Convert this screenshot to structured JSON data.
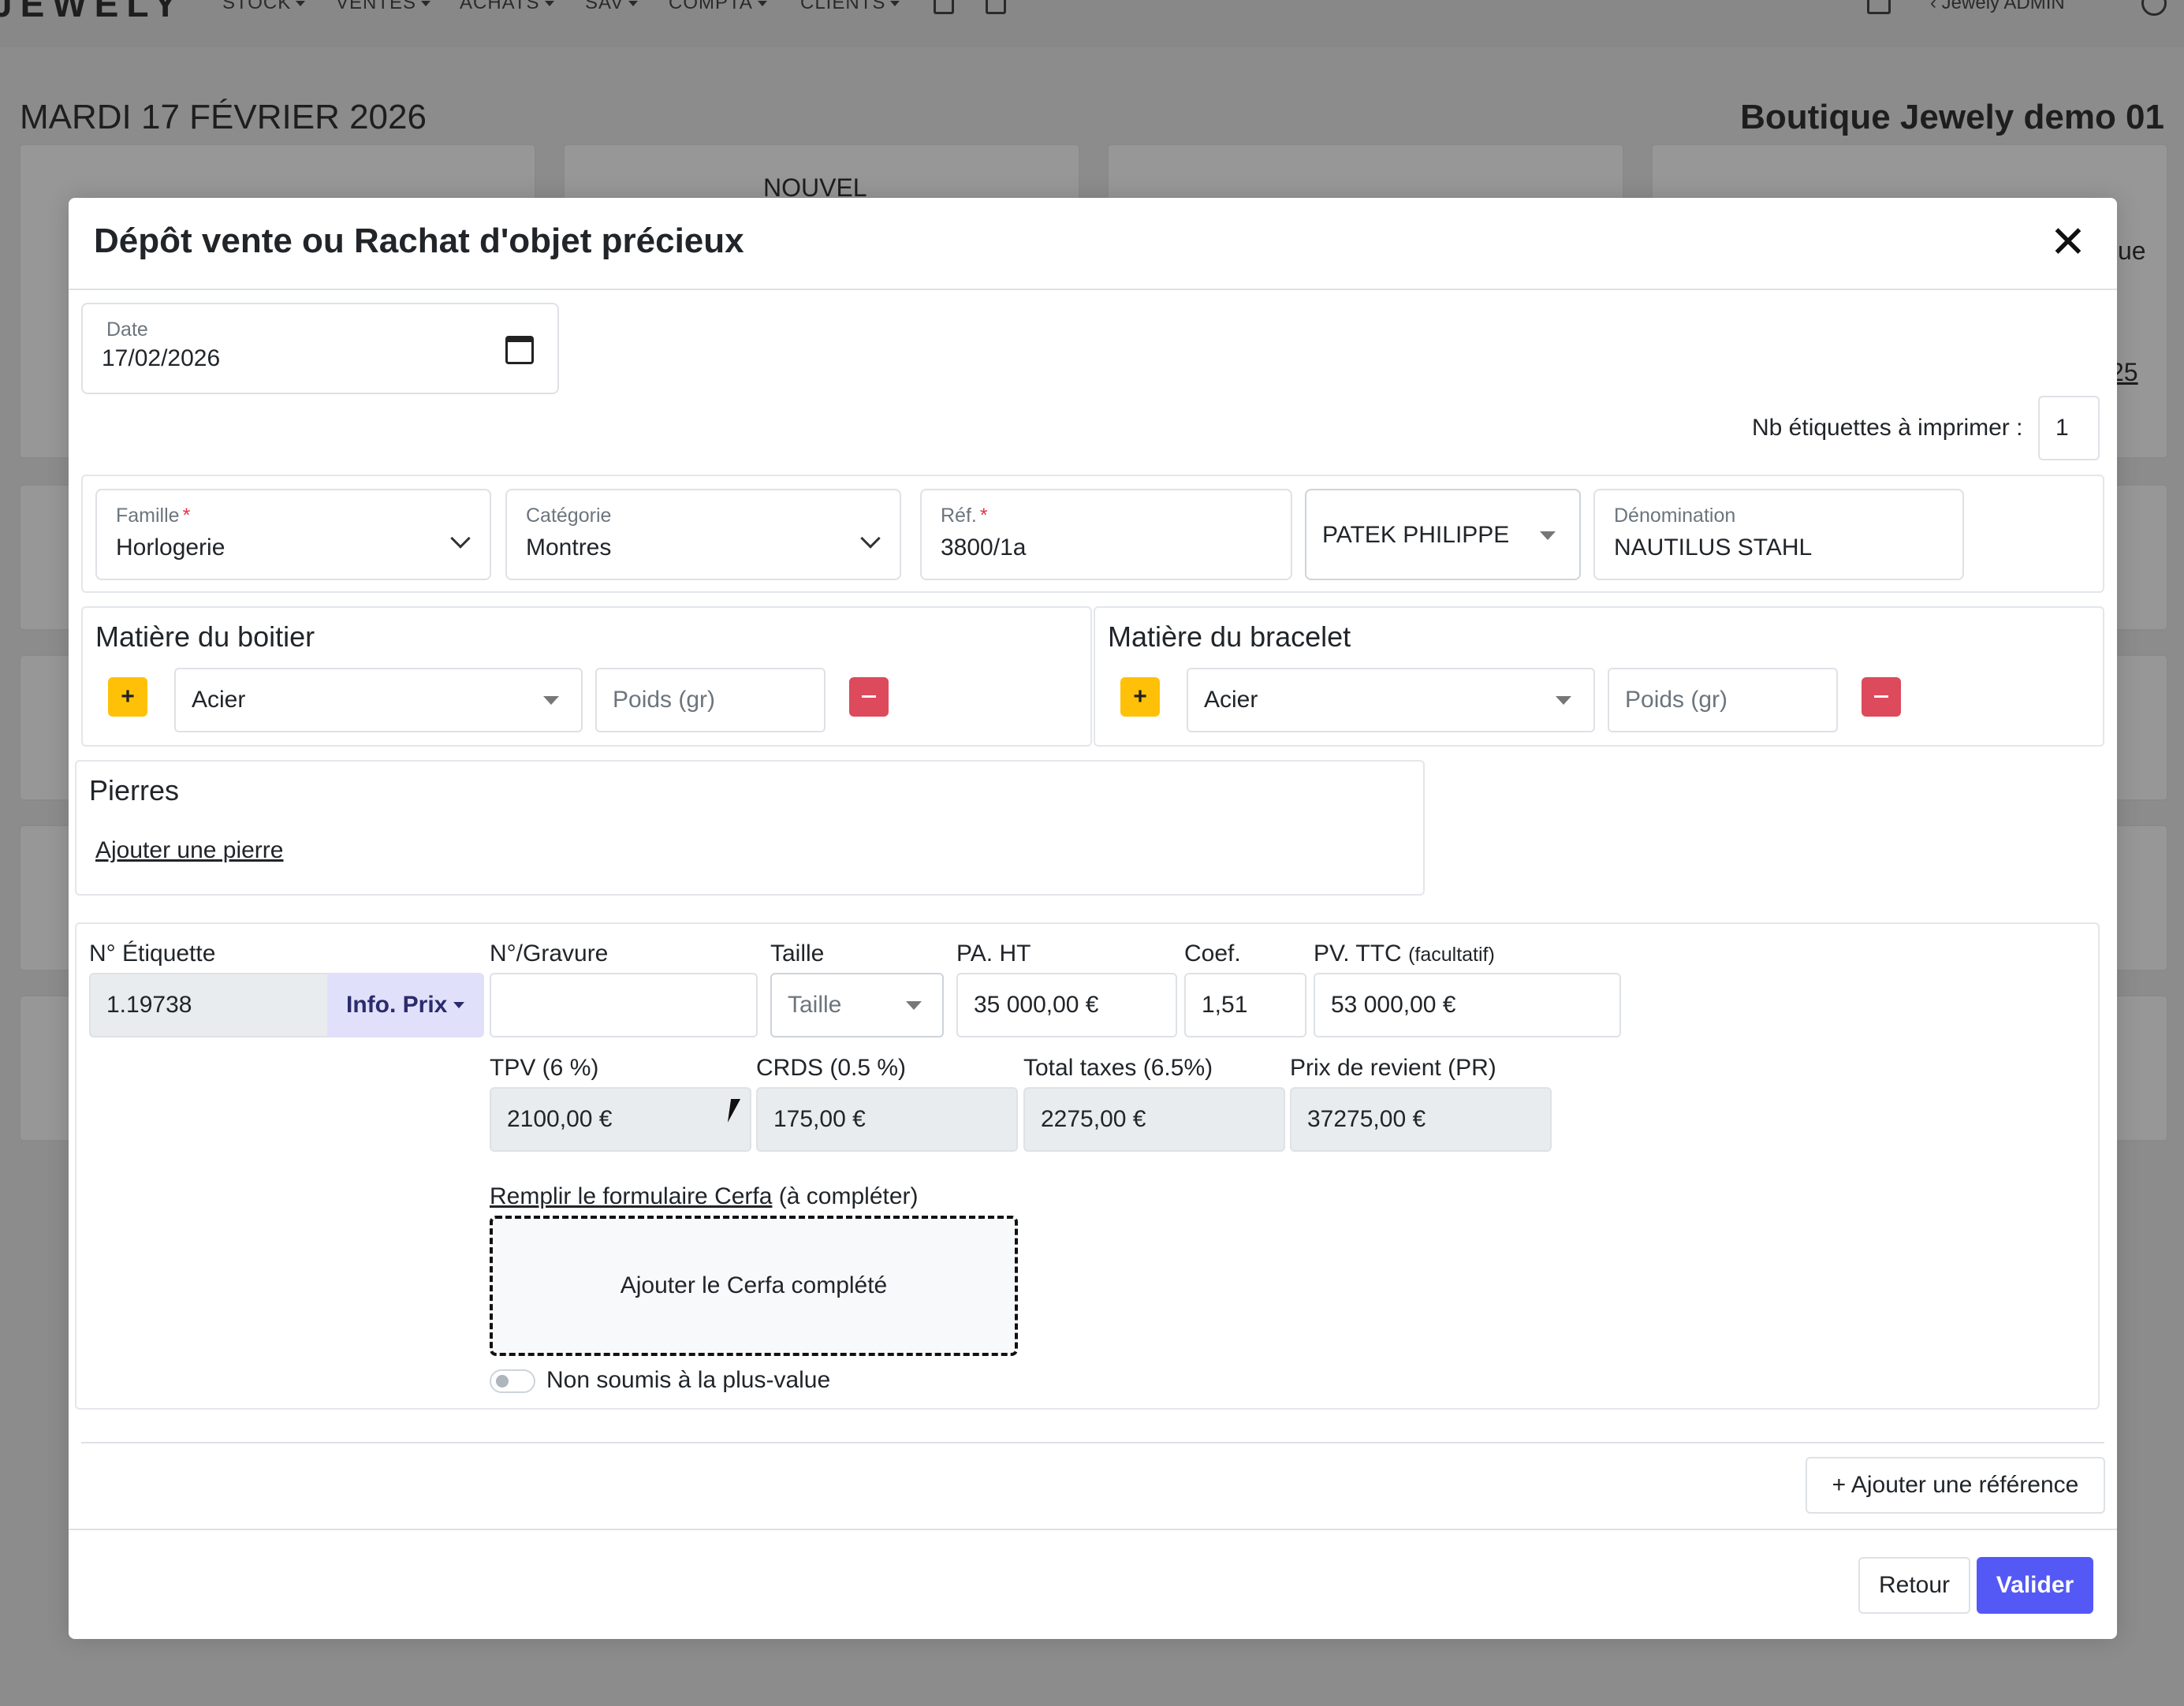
{
  "app": {
    "brand": "JEWELY",
    "nav": [
      "STOCK",
      "VENTES",
      "ACHATS",
      "SAV",
      "COMPTA",
      "CLIENTS"
    ],
    "user": "Jewely ADMIN",
    "date_heading": "MARDI 17 FÉVRIER 2026",
    "shop_name": "Boutique Jewely demo 01",
    "bg_card_text": "NOUVEL",
    "bg_side_text": "ue",
    "bg_side_link": "25"
  },
  "modal": {
    "title": "Dépôt vente ou Rachat d'objet précieux",
    "close": "✕",
    "date": {
      "label": "Date",
      "value": "17/02/2026"
    },
    "labels_count": {
      "label": "Nb étiquettes à imprimer :",
      "value": "1"
    },
    "famille": {
      "label": "Famille",
      "required": "*",
      "value": "Horlogerie"
    },
    "categorie": {
      "label": "Catégorie",
      "value": "Montres"
    },
    "ref": {
      "label": "Réf.",
      "required": "*",
      "value": "3800/1a"
    },
    "marque": {
      "value": "PATEK PHILIPPE"
    },
    "denomination": {
      "label": "Dénomination",
      "value": "NAUTILUS STAHL"
    },
    "boitier": {
      "title": "Matière du boitier",
      "plus": "+",
      "material": "Acier",
      "weight_placeholder": "Poids (gr)"
    },
    "bracelet": {
      "title": "Matière du bracelet",
      "plus": "+",
      "material": "Acier",
      "weight_placeholder": "Poids (gr)"
    },
    "pierres": {
      "title": "Pierres",
      "add_link": "Ajouter une pierre"
    },
    "item": {
      "etiquette_label": "N° Étiquette",
      "etiquette_value": "1.19738",
      "info_prix": "Info. Prix",
      "gravure_label": "N°/Gravure",
      "gravure_value": "",
      "taille_label": "Taille",
      "taille_value": "Taille",
      "pa_label": "PA. HT",
      "pa_value": "35 000,00 €",
      "coef_label": "Coef.",
      "coef_value": "1,51",
      "pv_label": "PV. TTC",
      "pv_sub": "(facultatif)",
      "pv_value": "53 000,00 €",
      "tpv_label": "TPV (6 %)",
      "tpv_value": "2100,00 €",
      "crds_label": "CRDS (0.5 %)",
      "crds_value": "175,00 €",
      "taxes_label": "Total taxes (6.5%)",
      "taxes_value": "2275,00 €",
      "pr_label": "Prix de revient (PR)",
      "pr_value": "37275,00 €",
      "cerfa_link": "Remplir le formulaire Cerfa",
      "cerfa_note": "(à compléter)",
      "cerfa_drop": "Ajouter le Cerfa complété",
      "plus_value_toggle": "Non soumis à la plus-value"
    },
    "add_reference": "+ Ajouter une référence",
    "footer": {
      "back": "Retour",
      "submit": "Valider"
    }
  }
}
